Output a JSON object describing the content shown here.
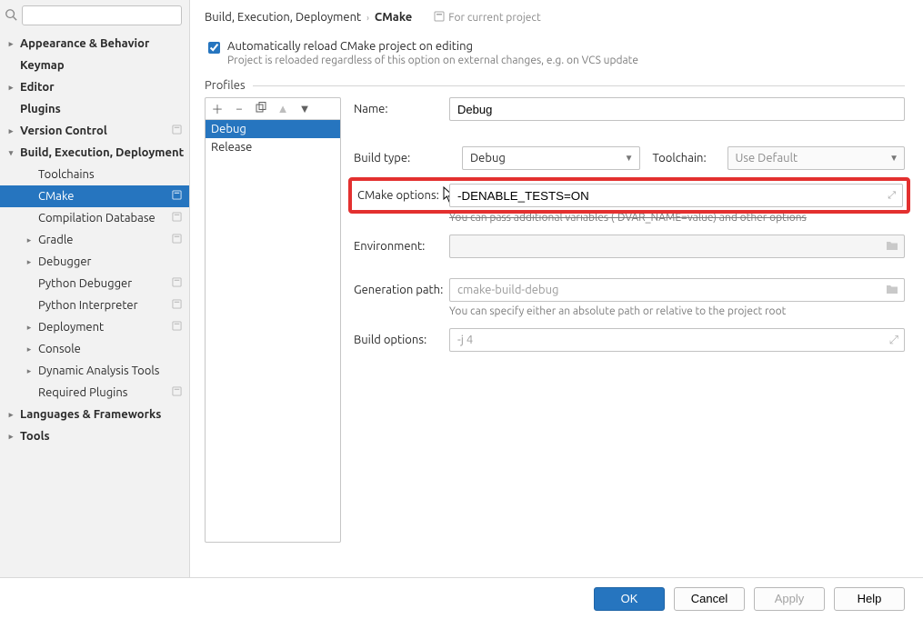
{
  "search": {
    "placeholder": ""
  },
  "sidebar": {
    "items": [
      {
        "label": "Appearance & Behavior",
        "depth": 0,
        "bold": true,
        "toggle": "right"
      },
      {
        "label": "Keymap",
        "depth": 0,
        "bold": true
      },
      {
        "label": "Editor",
        "depth": 0,
        "bold": true,
        "toggle": "right"
      },
      {
        "label": "Plugins",
        "depth": 0,
        "bold": true
      },
      {
        "label": "Version Control",
        "depth": 0,
        "bold": true,
        "toggle": "right",
        "badge": true
      },
      {
        "label": "Build, Execution, Deployment",
        "depth": 0,
        "bold": true,
        "toggle": "down"
      },
      {
        "label": "Toolchains",
        "depth": 1
      },
      {
        "label": "CMake",
        "depth": 1,
        "selected": true,
        "badge": true
      },
      {
        "label": "Compilation Database",
        "depth": 1,
        "badge": true
      },
      {
        "label": "Gradle",
        "depth": 1,
        "toggle": "right",
        "badge": true
      },
      {
        "label": "Debugger",
        "depth": 1,
        "toggle": "right"
      },
      {
        "label": "Python Debugger",
        "depth": 1,
        "badge": true
      },
      {
        "label": "Python Interpreter",
        "depth": 1,
        "badge": true
      },
      {
        "label": "Deployment",
        "depth": 1,
        "toggle": "right",
        "badge": true
      },
      {
        "label": "Console",
        "depth": 1,
        "toggle": "right"
      },
      {
        "label": "Dynamic Analysis Tools",
        "depth": 1,
        "toggle": "right"
      },
      {
        "label": "Required Plugins",
        "depth": 1,
        "badge": true
      },
      {
        "label": "Languages & Frameworks",
        "depth": 0,
        "bold": true,
        "toggle": "right"
      },
      {
        "label": "Tools",
        "depth": 0,
        "bold": true,
        "toggle": "right"
      }
    ]
  },
  "breadcrumb": {
    "parent": "Build, Execution, Deployment",
    "current": "CMake",
    "scope": "For current project"
  },
  "auto_reload": {
    "label": "Automatically reload CMake project on editing",
    "sub": "Project is reloaded regardless of this option on external changes, e.g. on VCS update"
  },
  "profiles": {
    "title": "Profiles",
    "items": [
      "Debug",
      "Release"
    ],
    "selected": "Debug"
  },
  "fields": {
    "name_label": "Name:",
    "name_value": "Debug",
    "build_type_label": "Build type:",
    "build_type_value": "Debug",
    "toolchain_label": "Toolchain:",
    "toolchain_value": "Use Default",
    "cmake_options_label": "CMake options:",
    "cmake_options_value": "-DENABLE_TESTS=ON",
    "cmake_options_hint": "You can pass additional variables (-DVAR_NAME=value) and other options",
    "environment_label": "Environment:",
    "generation_label": "Generation path:",
    "generation_placeholder": "cmake-build-debug",
    "generation_hint": "You can specify either an absolute path or relative to the project root",
    "build_options_label": "Build options:",
    "build_options_placeholder": "-j 4"
  },
  "footer": {
    "ok": "OK",
    "cancel": "Cancel",
    "apply": "Apply",
    "help": "Help"
  }
}
